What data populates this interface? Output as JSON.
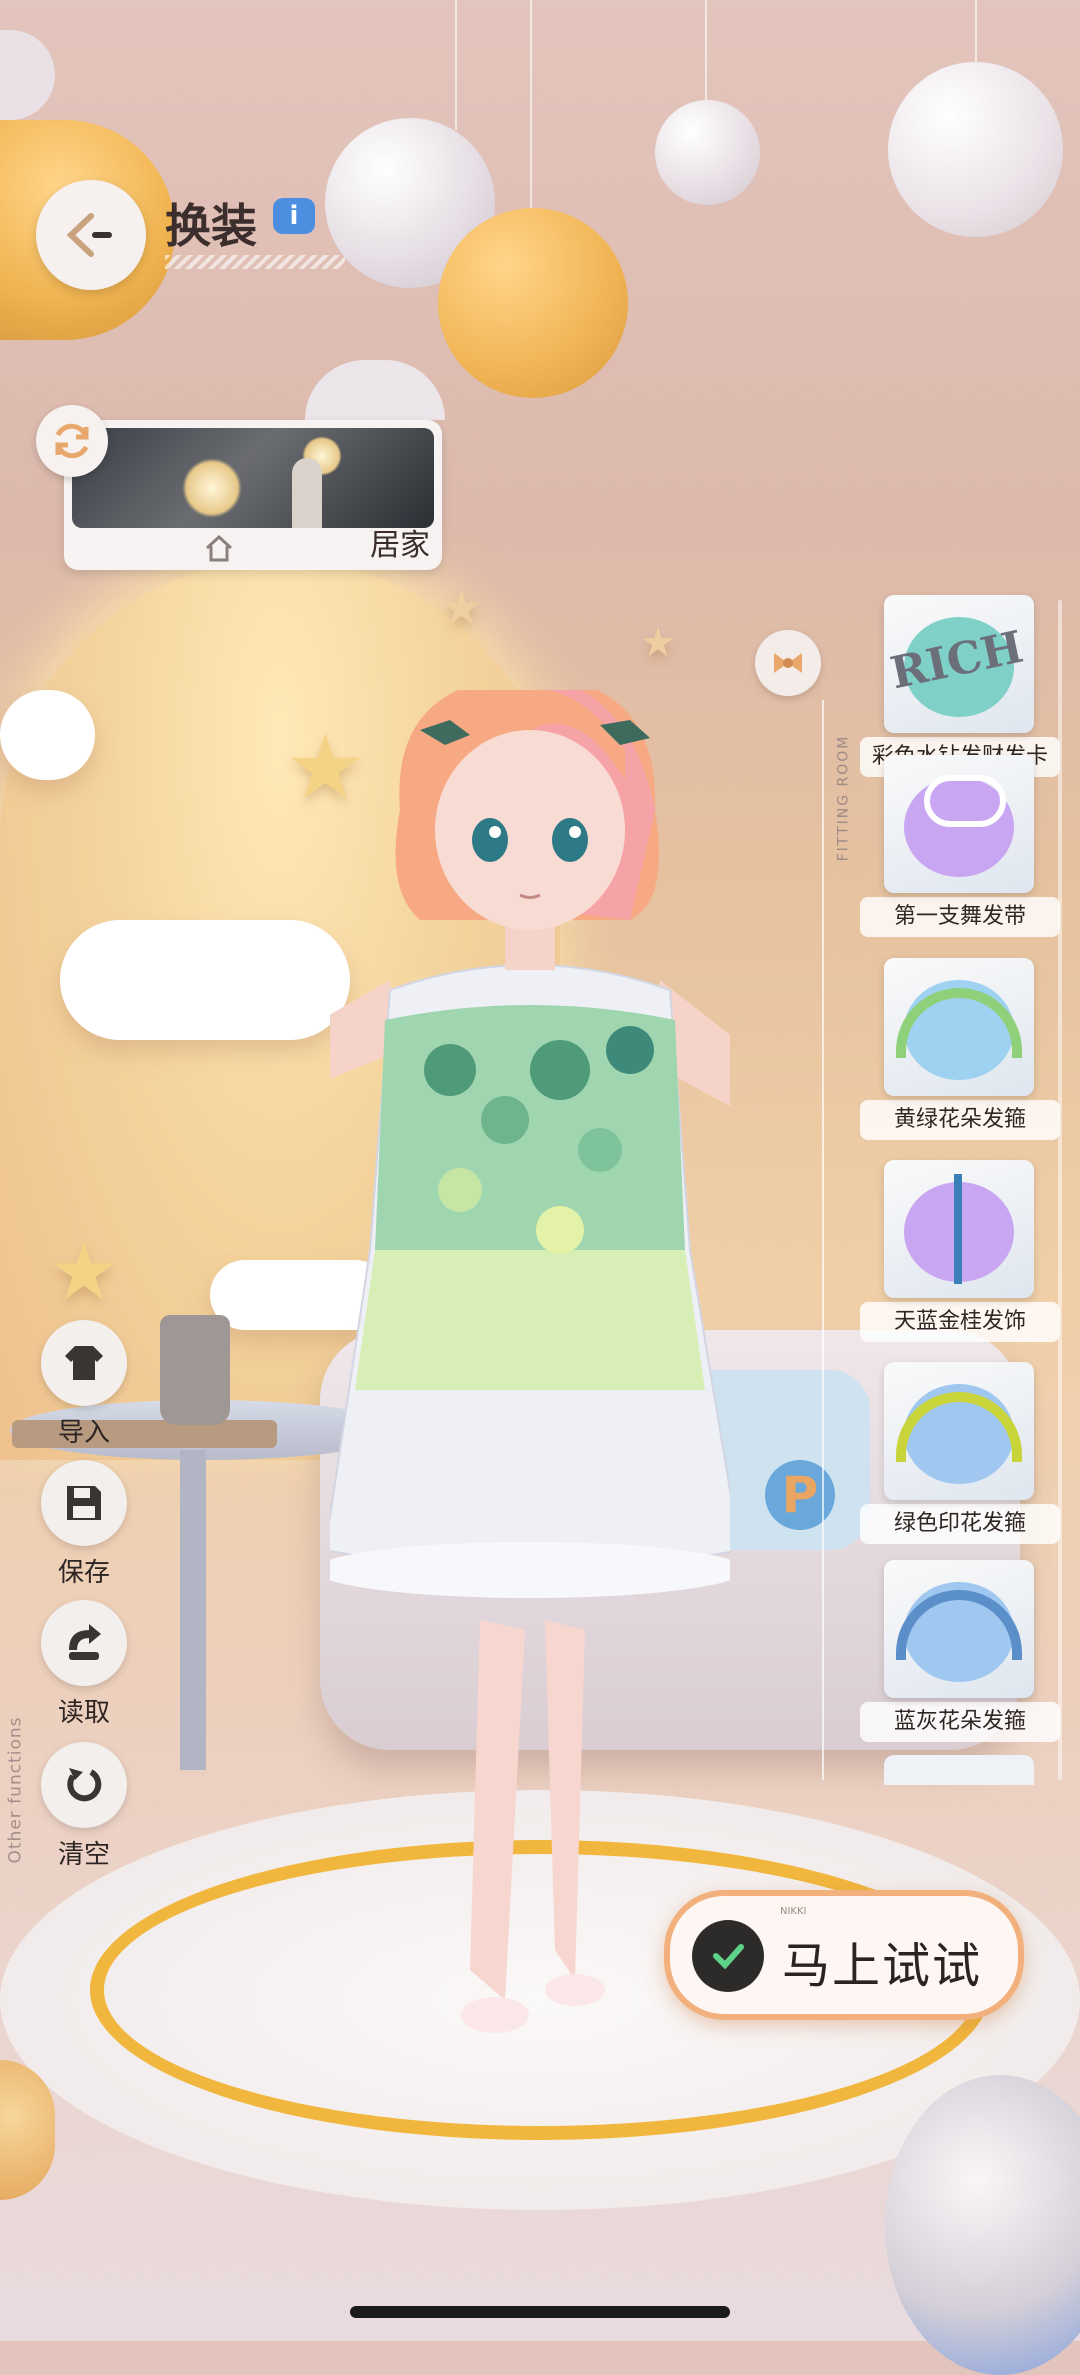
{
  "header": {
    "title": "换装",
    "info": "i"
  },
  "scene": {
    "label": "居家"
  },
  "functions": [
    {
      "label": "导入",
      "icon": "import-outfit-icon"
    },
    {
      "label": "保存",
      "icon": "save-icon"
    },
    {
      "label": "读取",
      "icon": "load-icon"
    },
    {
      "label": "清空",
      "icon": "clear-icon"
    }
  ],
  "other_functions_label": "Other functions",
  "fitting_room_label": "FITTING ROOM",
  "items": [
    {
      "label": "彩色水钻发财发卡",
      "art_text": "RICH",
      "color": "#7fd0c7"
    },
    {
      "label": "第一支舞发带",
      "color": "#c9a6f2"
    },
    {
      "label": "黄绿花朵发箍",
      "color": "#9fd1f0"
    },
    {
      "label": "天蓝金桂发饰",
      "color": "#c9a6f2"
    },
    {
      "label": "绿色印花发箍",
      "color": "#9fc7f0"
    },
    {
      "label": "蓝灰花朵发箍",
      "color": "#9fc7f0"
    }
  ],
  "try_button": {
    "label": "马上试试",
    "brand": "NIKKI"
  },
  "colors": {
    "accent": "#f1b07c",
    "info": "#4c8fe0",
    "ring": "#f1b63d"
  }
}
